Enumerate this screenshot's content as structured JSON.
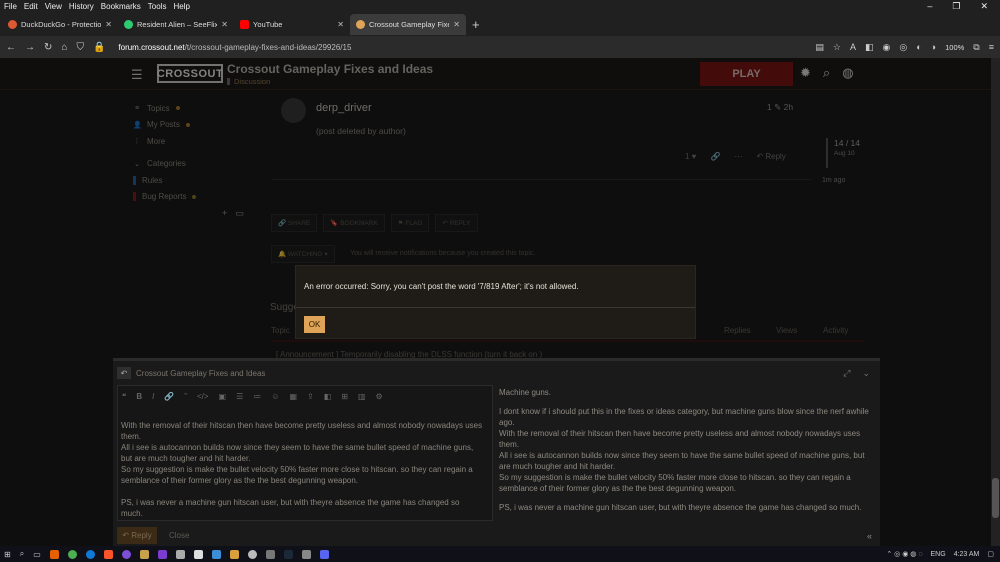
{
  "menu": [
    "File",
    "Edit",
    "View",
    "History",
    "Bookmarks",
    "Tools",
    "Help"
  ],
  "window_controls": [
    "–",
    "❐",
    "✕"
  ],
  "tabs": [
    {
      "label": "DuckDuckGo - Protection. Privacy",
      "color": "#de5833",
      "active": false
    },
    {
      "label": "Resident Alien – SeeFlix",
      "color": "#2ecc71",
      "active": false
    },
    {
      "label": "YouTube",
      "color": "#ff0000",
      "active": false
    },
    {
      "label": "Crossout Gameplay Fixes and Ideas",
      "color": "#e0a458",
      "active": true
    }
  ],
  "url": {
    "host": "forum.crossout.net",
    "path": "/t/crossout-gameplay-fixes-and-ideas/29926/15"
  },
  "zoom": "100%",
  "site": {
    "logo": "CROSSOUT",
    "topic_title": "Crossout Gameplay Fixes and Ideas",
    "category": "Discussion",
    "play_label": "PLAY"
  },
  "sidebar": {
    "items": [
      {
        "label": "Topics",
        "icon": "≡"
      },
      {
        "label": "My Posts",
        "icon": "👤"
      },
      {
        "label": "More",
        "icon": "⋮"
      }
    ],
    "categories_label": "Categories",
    "categories": [
      {
        "label": "Rules",
        "color": "#2a5fa8"
      },
      {
        "label": "Bug Reports",
        "color": "#8b1a1a"
      }
    ]
  },
  "post": {
    "author": "derp_driver",
    "reply_count": "1",
    "age": "2h",
    "body": "(post deleted by author)",
    "likes": "1",
    "reply_label": "Reply"
  },
  "timeline": {
    "count": "14 / 14",
    "date": "Aug 10",
    "ago": "1m ago"
  },
  "controls": {
    "share": "SHARE",
    "bookmark": "BOOKMARK",
    "flag": "FLAG",
    "reply": "REPLY",
    "watching": "WATCHING",
    "notification": "You will receive notifications because you created this topic."
  },
  "suggested": {
    "heading": "Sugge",
    "col_topic": "Topic",
    "col_replies": "Replies",
    "col_views": "Views",
    "col_activity": "Activity",
    "announcement": "[ Announcement ] Temporarily disabling the DLSS function (turn it back on )"
  },
  "modal": {
    "message": "An error occurred: Sorry, you can't post the word '7/819 After'; it's not allowed.",
    "ok_label": "OK"
  },
  "composer": {
    "title": "Crossout Gameplay Fixes and Ideas",
    "editor_lines": [
      "With the removal of their hitscan then have become pretty useless and almost nobody nowadays uses them.",
      "All i see is autocannon builds now since they seem to have the same bullet speed of machine guns, but are much tougher and hit harder.",
      "So my suggestion is make the bullet velocity 50% faster more close to hitscan. so they can regain a semblance of their former glory as the the best degunning weapon.",
      "",
      "PS, i was never a machine gun hitscan user, but with theyre absence the game has changed so much."
    ],
    "preview_title": "Machine guns.",
    "preview_lines": [
      "I dont know if i should put this in the fixes or ideas category, but machine guns blow since the nerf awhile ago.",
      "With the removal of their hitscan then have become pretty useless and almost nobody nowadays uses them.",
      "All i see is autocannon builds now since they seem to have the same bullet speed of machine guns, but are much tougher and hit harder.",
      "So my suggestion is make the bullet velocity 50% faster more close to hitscan. so they can regain a semblance of their former glory as the the best degunning weapon."
    ],
    "preview_ps": "PS, i was never a machine gun hitscan user, but with theyre absence the game has changed so much.",
    "reply_label": "Reply",
    "close_label": "Close"
  },
  "taskbar": {
    "lang": "ENG",
    "time": "4:23 AM"
  }
}
